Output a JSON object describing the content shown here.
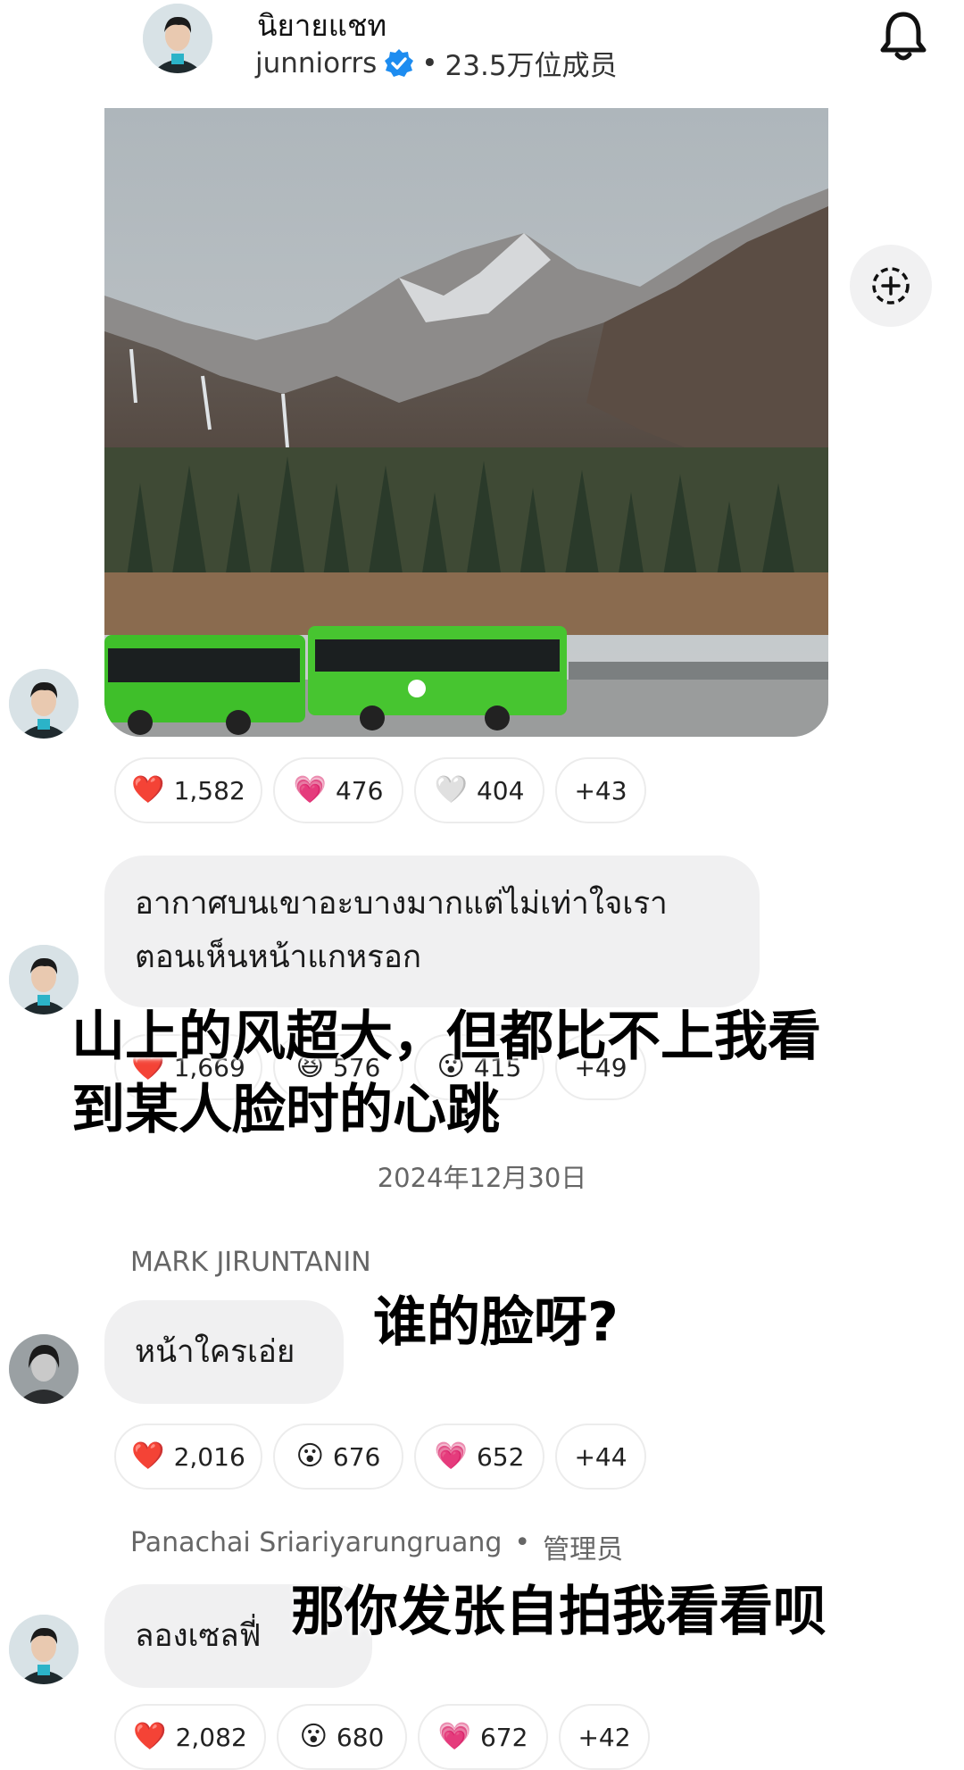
{
  "header": {
    "title": "นิยายแชท",
    "account": "junniorrs",
    "separator": "•",
    "members": "23.5万位成员",
    "icons": {
      "notification": "bell-icon",
      "verified": "verified-badge-icon"
    }
  },
  "messages": [
    {
      "type": "image",
      "reactions": [
        {
          "emoji": "❤️",
          "count": "1,582"
        },
        {
          "emoji": "💗",
          "count": "476"
        },
        {
          "emoji": "🤍",
          "count": "404"
        },
        {
          "emoji": "",
          "count": "+43"
        }
      ]
    },
    {
      "type": "text",
      "text_line1": "อากาศบนเขาอะบางมากแต่ไม่เท่าใจเรา",
      "text_line2": "ตอนเห็นหน้าแกหรอก",
      "overlay_line1": "山上的风超大，但都比不上我看",
      "overlay_line2": "到某人脸时的心跳",
      "reactions": [
        {
          "emoji": "❤️",
          "count": "1,669"
        },
        {
          "emoji": "😆",
          "count": "576"
        },
        {
          "emoji": "😮",
          "count": "415"
        },
        {
          "emoji": "",
          "count": "+49"
        }
      ]
    },
    {
      "type": "text",
      "sender": "MARK JIRUNTANIN",
      "text": "หน้าใครเอ่ย",
      "overlay": "谁的脸呀?",
      "reactions": [
        {
          "emoji": "❤️",
          "count": "2,016"
        },
        {
          "emoji": "😮",
          "count": "676"
        },
        {
          "emoji": "💗",
          "count": "652"
        },
        {
          "emoji": "",
          "count": "+44"
        }
      ]
    },
    {
      "type": "text",
      "sender": "Panachai Sriariyarungruang",
      "sender_role": "管理员",
      "separator": "•",
      "text": "ลองเซลฟี่",
      "overlay": "那你发张自拍我看看呗",
      "reactions": [
        {
          "emoji": "❤️",
          "count": "2,082"
        },
        {
          "emoji": "😮",
          "count": "680"
        },
        {
          "emoji": "💗",
          "count": "672"
        },
        {
          "emoji": "",
          "count": "+42"
        }
      ]
    }
  ],
  "date_divider": "2024年12月30日",
  "colors": {
    "bubble": "#f0f0f1",
    "verified": "#1d8cf0",
    "bus_green": "#3fbf2a"
  }
}
